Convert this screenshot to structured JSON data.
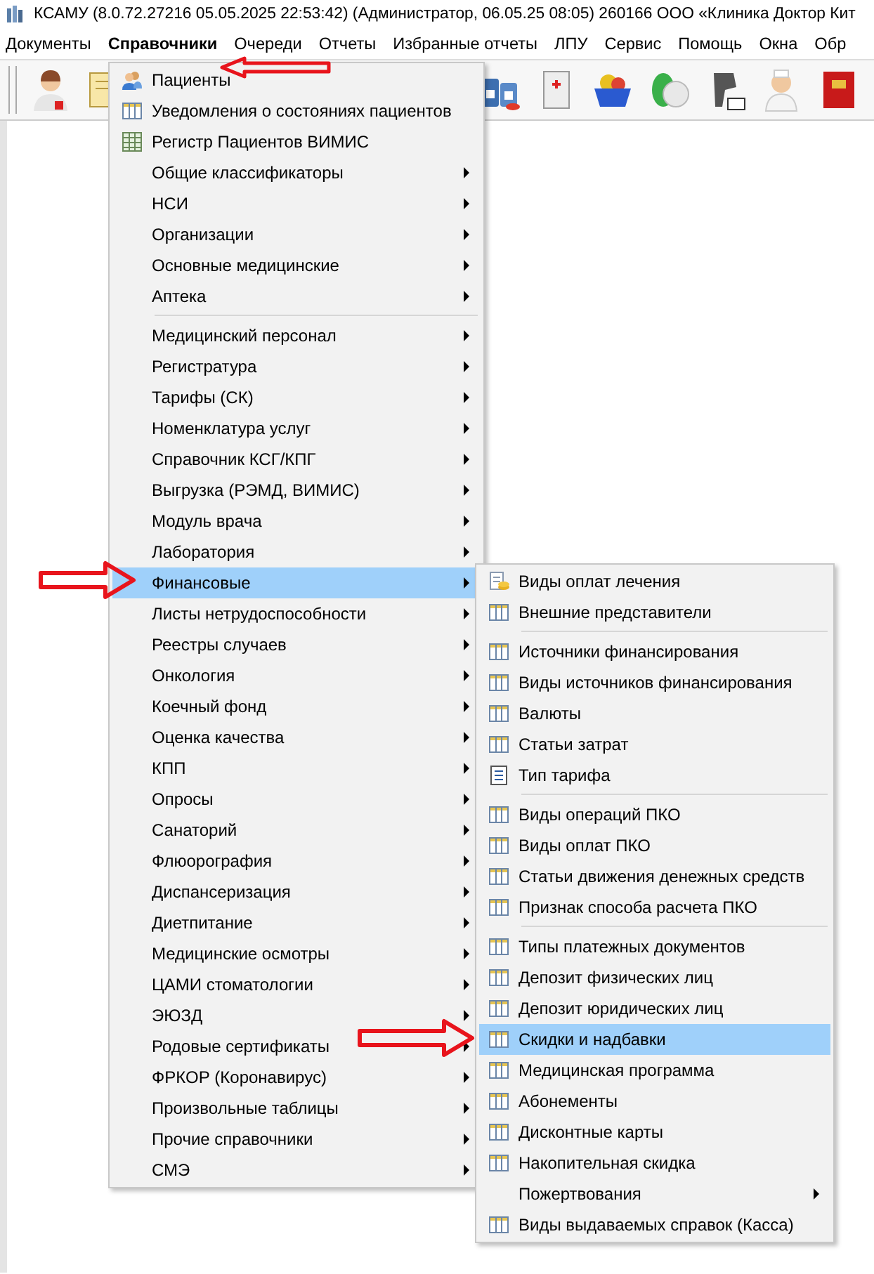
{
  "window": {
    "title": "КСАМУ (8.0.72.27216 05.05.2025 22:53:42) (Администратор, 06.05.25 08:05)  260166 ООО «Клиника Доктор Кит"
  },
  "menubar": [
    {
      "label": "Документы",
      "selected": false
    },
    {
      "label": "Справочники",
      "selected": true
    },
    {
      "label": "Очереди",
      "selected": false
    },
    {
      "label": "Отчеты",
      "selected": false
    },
    {
      "label": "Избранные отчеты",
      "selected": false
    },
    {
      "label": "ЛПУ",
      "selected": false
    },
    {
      "label": "Сервис",
      "selected": false
    },
    {
      "label": "Помощь",
      "selected": false
    },
    {
      "label": "Окна",
      "selected": false
    },
    {
      "label": "Обр",
      "selected": false
    }
  ],
  "menu": [
    {
      "label": "Пациенты",
      "kind": "people",
      "submenu": false,
      "selected": false,
      "separator_before": false
    },
    {
      "label": "Уведомления о состояниях пациентов",
      "kind": "table",
      "submenu": false,
      "selected": false,
      "separator_before": false
    },
    {
      "label": "Регистр Пациентов ВИМИС",
      "kind": "spreadsheet",
      "submenu": false,
      "selected": false,
      "separator_before": false
    },
    {
      "label": "Общие классификаторы",
      "kind": "plain",
      "submenu": true,
      "selected": false,
      "separator_before": false
    },
    {
      "label": "НСИ",
      "kind": "plain",
      "submenu": true,
      "selected": false,
      "separator_before": false
    },
    {
      "label": "Организации",
      "kind": "plain",
      "submenu": true,
      "selected": false,
      "separator_before": false
    },
    {
      "label": "Основные медицинские",
      "kind": "plain",
      "submenu": true,
      "selected": false,
      "separator_before": false
    },
    {
      "label": "Аптека",
      "kind": "plain",
      "submenu": true,
      "selected": false,
      "separator_before": false
    },
    {
      "label": "Медицинский персонал",
      "kind": "plain",
      "submenu": true,
      "selected": false,
      "separator_before": true
    },
    {
      "label": "Регистратура",
      "kind": "plain",
      "submenu": true,
      "selected": false,
      "separator_before": false
    },
    {
      "label": "Тарифы (СК)",
      "kind": "plain",
      "submenu": true,
      "selected": false,
      "separator_before": false
    },
    {
      "label": "Номенклатура услуг",
      "kind": "plain",
      "submenu": true,
      "selected": false,
      "separator_before": false
    },
    {
      "label": "Справочник КСГ/КПГ",
      "kind": "plain",
      "submenu": true,
      "selected": false,
      "separator_before": false
    },
    {
      "label": "Выгрузка (РЭМД, ВИМИС)",
      "kind": "plain",
      "submenu": true,
      "selected": false,
      "separator_before": false
    },
    {
      "label": "Модуль врача",
      "kind": "plain",
      "submenu": true,
      "selected": false,
      "separator_before": false
    },
    {
      "label": "Лаборатория",
      "kind": "plain",
      "submenu": true,
      "selected": false,
      "separator_before": false
    },
    {
      "label": "Финансовые",
      "kind": "plain",
      "submenu": true,
      "selected": true,
      "separator_before": false
    },
    {
      "label": "Листы нетрудоспособности",
      "kind": "plain",
      "submenu": true,
      "selected": false,
      "separator_before": false
    },
    {
      "label": "Реестры случаев",
      "kind": "plain",
      "submenu": true,
      "selected": false,
      "separator_before": false
    },
    {
      "label": "Онкология",
      "kind": "plain",
      "submenu": true,
      "selected": false,
      "separator_before": false
    },
    {
      "label": "Коечный фонд",
      "kind": "plain",
      "submenu": true,
      "selected": false,
      "separator_before": false
    },
    {
      "label": "Оценка качества",
      "kind": "plain",
      "submenu": true,
      "selected": false,
      "separator_before": false
    },
    {
      "label": "КПП",
      "kind": "plain",
      "submenu": true,
      "selected": false,
      "separator_before": false
    },
    {
      "label": "Опросы",
      "kind": "plain",
      "submenu": true,
      "selected": false,
      "separator_before": false
    },
    {
      "label": "Санаторий",
      "kind": "plain",
      "submenu": true,
      "selected": false,
      "separator_before": false
    },
    {
      "label": "Флюорография",
      "kind": "plain",
      "submenu": true,
      "selected": false,
      "separator_before": false
    },
    {
      "label": "Диспансеризация",
      "kind": "plain",
      "submenu": true,
      "selected": false,
      "separator_before": false
    },
    {
      "label": "Диетпитание",
      "kind": "plain",
      "submenu": true,
      "selected": false,
      "separator_before": false
    },
    {
      "label": "Медицинские осмотры",
      "kind": "plain",
      "submenu": true,
      "selected": false,
      "separator_before": false
    },
    {
      "label": "ЦАМИ стоматологии",
      "kind": "plain",
      "submenu": true,
      "selected": false,
      "separator_before": false
    },
    {
      "label": "ЭЮЗД",
      "kind": "plain",
      "submenu": true,
      "selected": false,
      "separator_before": false
    },
    {
      "label": "Родовые сертификаты",
      "kind": "plain",
      "submenu": true,
      "selected": false,
      "separator_before": false
    },
    {
      "label": "ФРКОР (Коронавирус)",
      "kind": "plain",
      "submenu": true,
      "selected": false,
      "separator_before": false
    },
    {
      "label": "Произвольные таблицы",
      "kind": "plain",
      "submenu": true,
      "selected": false,
      "separator_before": false
    },
    {
      "label": "Прочие справочники",
      "kind": "plain",
      "submenu": true,
      "selected": false,
      "separator_before": false
    },
    {
      "label": "СМЭ",
      "kind": "plain",
      "submenu": true,
      "selected": false,
      "separator_before": false
    }
  ],
  "submenu": [
    {
      "label": "Виды оплат лечения",
      "kind": "payment",
      "submenu": false,
      "selected": false,
      "separator_before": false
    },
    {
      "label": "Внешние представители",
      "kind": "table",
      "submenu": false,
      "selected": false,
      "separator_before": false
    },
    {
      "label": "Источники финансирования",
      "kind": "table",
      "submenu": false,
      "selected": false,
      "separator_before": true
    },
    {
      "label": "Виды источников финансирования",
      "kind": "table",
      "submenu": false,
      "selected": false,
      "separator_before": false
    },
    {
      "label": "Валюты",
      "kind": "table",
      "submenu": false,
      "selected": false,
      "separator_before": false
    },
    {
      "label": "Статьи затрат",
      "kind": "table",
      "submenu": false,
      "selected": false,
      "separator_before": false
    },
    {
      "label": "Тип тарифа",
      "kind": "list",
      "submenu": false,
      "selected": false,
      "separator_before": false
    },
    {
      "label": "Виды операций ПКО",
      "kind": "table",
      "submenu": false,
      "selected": false,
      "separator_before": true
    },
    {
      "label": "Виды оплат ПКО",
      "kind": "table",
      "submenu": false,
      "selected": false,
      "separator_before": false
    },
    {
      "label": "Статьи движения денежных средств",
      "kind": "table",
      "submenu": false,
      "selected": false,
      "separator_before": false
    },
    {
      "label": "Признак способа расчета ПКО",
      "kind": "table",
      "submenu": false,
      "selected": false,
      "separator_before": false
    },
    {
      "label": "Типы платежных документов",
      "kind": "table",
      "submenu": false,
      "selected": false,
      "separator_before": true
    },
    {
      "label": "Депозит физических лиц",
      "kind": "table",
      "submenu": false,
      "selected": false,
      "separator_before": false
    },
    {
      "label": "Депозит юридических лиц",
      "kind": "table",
      "submenu": false,
      "selected": false,
      "separator_before": false
    },
    {
      "label": "Скидки и надбавки",
      "kind": "table",
      "submenu": false,
      "selected": true,
      "separator_before": false
    },
    {
      "label": "Медицинская программа",
      "kind": "table",
      "submenu": false,
      "selected": false,
      "separator_before": false
    },
    {
      "label": "Абонементы",
      "kind": "table",
      "submenu": false,
      "selected": false,
      "separator_before": false
    },
    {
      "label": "Дисконтные карты",
      "kind": "table",
      "submenu": false,
      "selected": false,
      "separator_before": false
    },
    {
      "label": "Накопительная скидка",
      "kind": "table",
      "submenu": false,
      "selected": false,
      "separator_before": false
    },
    {
      "label": "Пожертвования",
      "kind": "plain",
      "submenu": true,
      "selected": false,
      "separator_before": false
    },
    {
      "label": "Виды выдаваемых справок (Касса)",
      "kind": "table",
      "submenu": false,
      "selected": false,
      "separator_before": false
    }
  ]
}
